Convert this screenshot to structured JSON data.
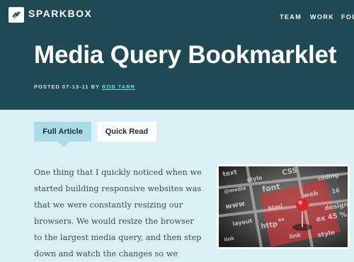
{
  "header": {
    "brand": "SPARKBOX",
    "nav": [
      "TEAM",
      "WORK",
      "FOU"
    ],
    "title": "Media Query Bookmarklet",
    "meta_prefix": "POSTED 07-13-11 BY",
    "author": "ROB TARR"
  },
  "tabs": [
    {
      "label": "Full Article",
      "active": true
    },
    {
      "label": "Quick Read",
      "active": false
    }
  ],
  "article": {
    "text": "One thing that I quickly noticed when we started building responsive websites was that we were constantly resizing our browsers. We would resize the browser to the largest media query, and then step down and watch the changes so we"
  },
  "photo": {
    "words": [
      "text",
      "style",
      "CSS",
      "coding",
      "@media",
      "font",
      "web",
      "www",
      "html",
      "design",
      "layout",
      "http",
      "link",
      "style",
      "link",
      "ex 45 %",
      "ex",
      "16"
    ]
  },
  "colors": {
    "header_bg": "#1f4a54",
    "page_bg": "#d9f1f5",
    "active_tab": "#a9dce6",
    "link": "#7ccfe0",
    "pin": "#d8262e"
  }
}
